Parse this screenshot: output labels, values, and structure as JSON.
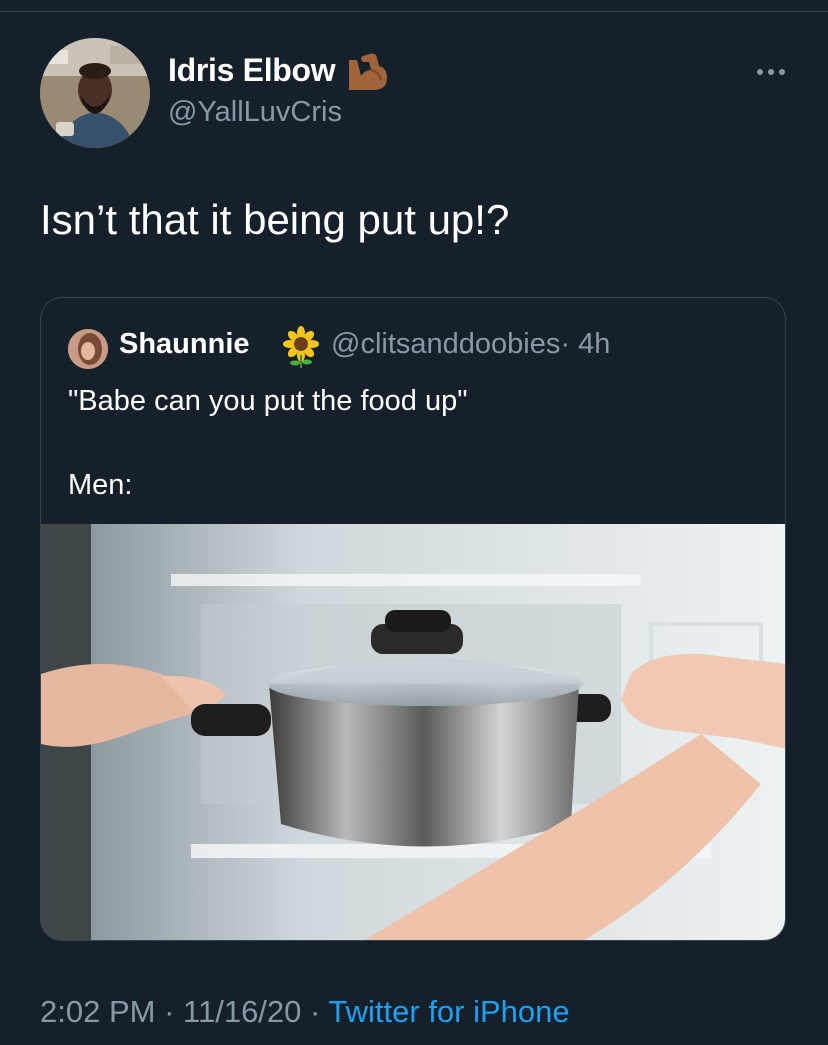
{
  "tweet": {
    "author": {
      "name": "Idris Elbow",
      "name_emoji": "flexed-biceps-emoji",
      "handle": "@YallLuvCris"
    },
    "text": "Isn’t that it being put up!?",
    "more_icon": "more-dots-icon",
    "quoted": {
      "name": "Shaunnie",
      "name_emoji": "sunflower-emoji",
      "handle": "@clitsanddoobies",
      "time": "· 4h",
      "text_line1": "\"Babe can you put the food up\"",
      "text_line2": "Men:"
    },
    "meta": {
      "time": "2:02 PM",
      "sep1": "·",
      "date": "11/16/20",
      "sep2": "·",
      "source": "Twitter for iPhone"
    }
  },
  "colors": {
    "background": "#15202b",
    "primary_text": "#ffffff",
    "secondary_text": "#8899a6",
    "link": "#1da1f2",
    "border": "#38444d"
  }
}
